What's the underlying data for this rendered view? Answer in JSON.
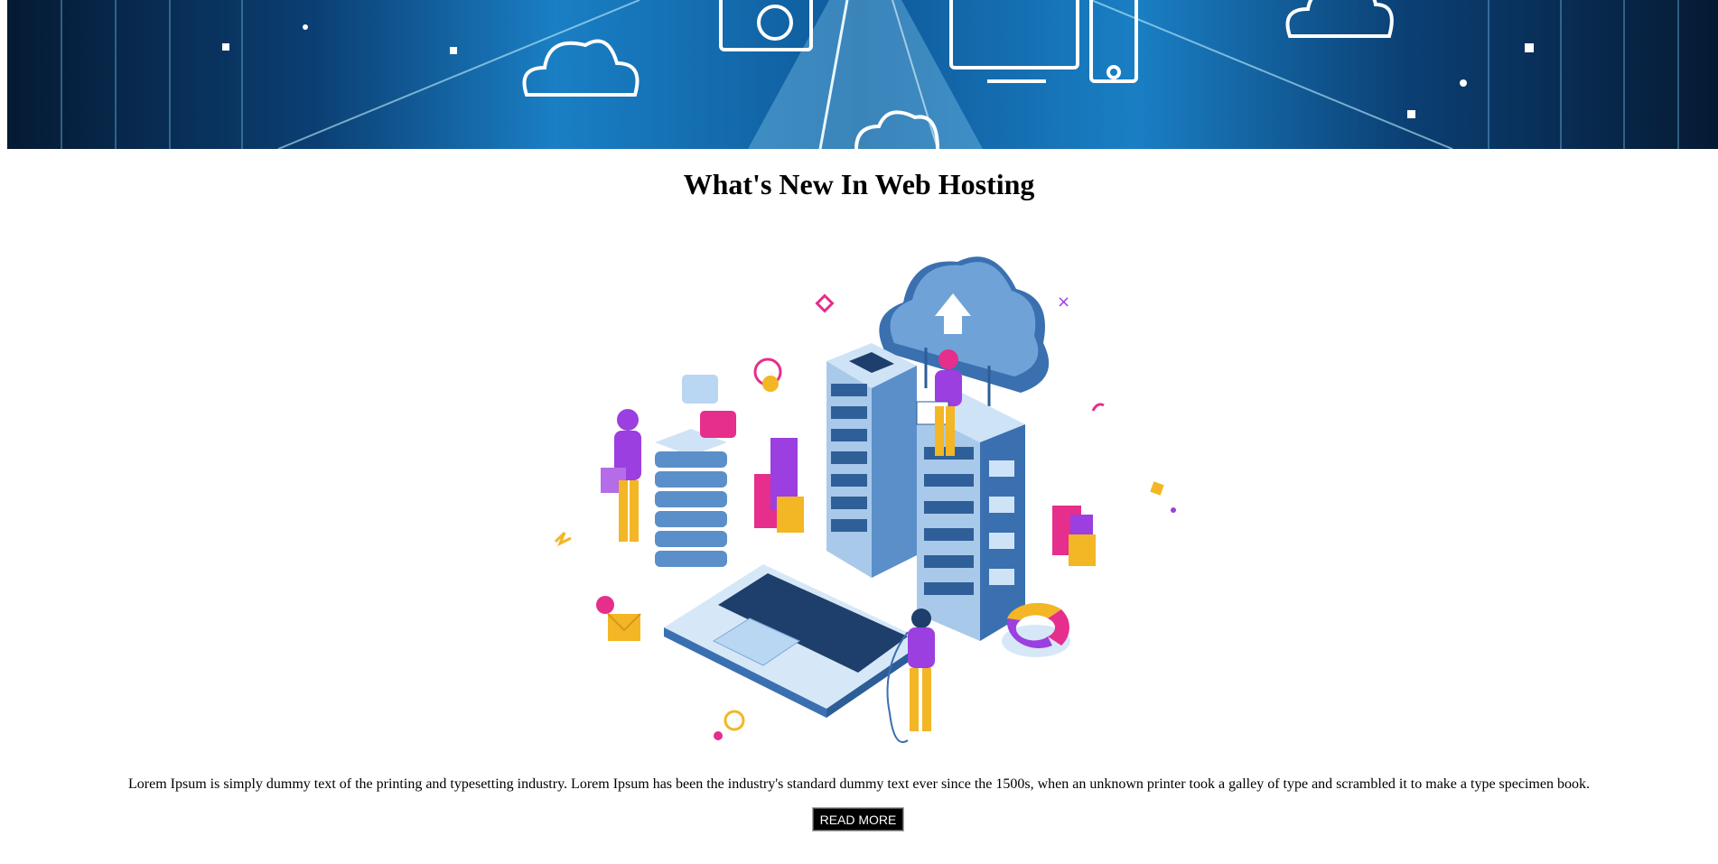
{
  "banner": {
    "alt": "cloud data center banner"
  },
  "article": {
    "title": "What's New In Web Hosting",
    "body": "Lorem Ipsum is simply dummy text of the printing and typesetting industry. Lorem Ipsum has been the industry's standard dummy text ever since the 1500s, when an unknown printer took a galley of type and scrambled it to make a type specimen book.",
    "read_more_label": "READ MORE"
  },
  "colors": {
    "banner_blue": "#1a7fc4",
    "server_blue": "#4a7fb5",
    "accent_purple": "#9b3fe0",
    "accent_pink": "#e62e8c",
    "accent_yellow": "#f3b625",
    "button_bg": "#000000"
  }
}
